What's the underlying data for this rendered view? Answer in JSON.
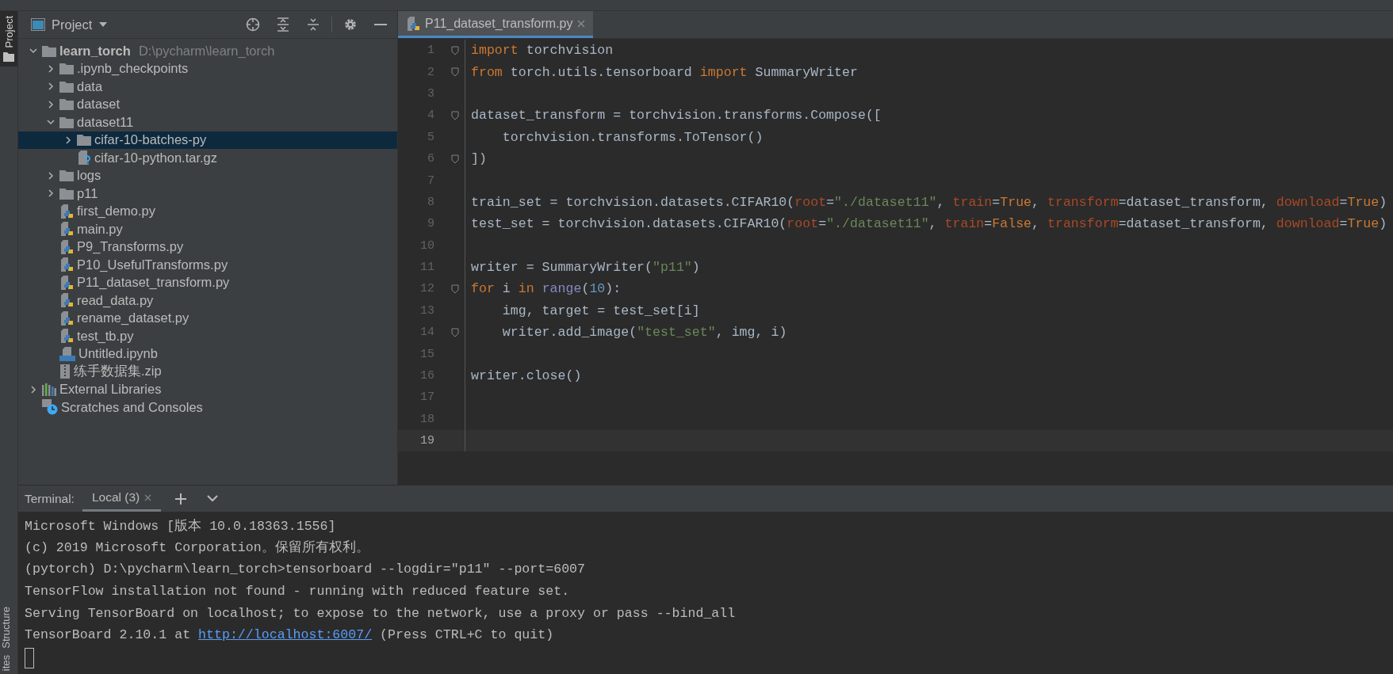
{
  "left_strip": {
    "tabs": [
      {
        "label": "Project",
        "selected": true
      }
    ],
    "bottom_tabs": [
      {
        "label": "Structure"
      },
      {
        "label": "ites"
      }
    ]
  },
  "project_panel": {
    "title": "Project",
    "tree": [
      {
        "label": "learn_torch",
        "path": "D:\\pycharm\\learn_torch",
        "kind": "folder",
        "expanded": true,
        "selected": false,
        "children": [
          {
            "label": ".ipynb_checkpoints",
            "kind": "folder",
            "expanded": false,
            "selected": false
          },
          {
            "label": "data",
            "kind": "folder",
            "expanded": false,
            "selected": false
          },
          {
            "label": "dataset",
            "kind": "folder",
            "expanded": false,
            "selected": false
          },
          {
            "label": "dataset11",
            "kind": "folder",
            "expanded": true,
            "selected": false,
            "children": [
              {
                "label": "cifar-10-batches-py",
                "kind": "folder",
                "expanded": false,
                "selected": true
              },
              {
                "label": "cifar-10-python.tar.gz",
                "kind": "unknown",
                "selected": false
              }
            ]
          },
          {
            "label": "logs",
            "kind": "folder",
            "expanded": false,
            "selected": false
          },
          {
            "label": "p11",
            "kind": "folder",
            "expanded": false,
            "selected": false
          },
          {
            "label": "first_demo.py",
            "kind": "python",
            "selected": false
          },
          {
            "label": "main.py",
            "kind": "python",
            "selected": false
          },
          {
            "label": "P9_Transforms.py",
            "kind": "python",
            "selected": false
          },
          {
            "label": "P10_UsefulTransforms.py",
            "kind": "python",
            "selected": false
          },
          {
            "label": "P11_dataset_transform.py",
            "kind": "python",
            "selected": false
          },
          {
            "label": "read_data.py",
            "kind": "python",
            "selected": false
          },
          {
            "label": "rename_dataset.py",
            "kind": "python",
            "selected": false
          },
          {
            "label": "test_tb.py",
            "kind": "python",
            "selected": false
          },
          {
            "label": "Untitled.ipynb",
            "kind": "notebook",
            "selected": false
          },
          {
            "label": "练手数据集.zip",
            "kind": "zip",
            "selected": false
          }
        ]
      },
      {
        "label": "External Libraries",
        "kind": "libraries",
        "expanded": false,
        "selected": false
      },
      {
        "label": "Scratches and Consoles",
        "kind": "scratches",
        "selected": false
      }
    ]
  },
  "editor": {
    "tabs": [
      {
        "label": "P11_dataset_transform.py",
        "selected": true
      }
    ],
    "lines": [
      {
        "number": "1",
        "fold": true,
        "current": false,
        "tokens": [
          {
            "text": "import",
            "kind": "kw"
          },
          {
            "text": " torchvision",
            "kind": "plain"
          }
        ]
      },
      {
        "number": "2",
        "fold": true,
        "current": false,
        "tokens": [
          {
            "text": "from",
            "kind": "kw"
          },
          {
            "text": " torch.utils.tensorboard ",
            "kind": "plain"
          },
          {
            "text": "import",
            "kind": "kw"
          },
          {
            "text": " SummaryWriter",
            "kind": "plain"
          }
        ]
      },
      {
        "number": "3",
        "fold": false,
        "current": false
      },
      {
        "number": "4",
        "fold": true,
        "current": false,
        "tokens": [
          {
            "text": "dataset_transform = torchvision.transforms.Compose([",
            "kind": "plain"
          }
        ]
      },
      {
        "number": "5",
        "fold": false,
        "current": false,
        "tokens": [
          {
            "text": "    torchvision.transforms.ToTensor()",
            "kind": "plain"
          }
        ]
      },
      {
        "number": "6",
        "fold": true,
        "current": false,
        "tokens": [
          {
            "text": "])",
            "kind": "plain"
          }
        ]
      },
      {
        "number": "7",
        "fold": false,
        "current": false
      },
      {
        "number": "8",
        "fold": false,
        "current": false,
        "tokens": [
          {
            "text": "train_set = torchvision.datasets.CIFAR10(",
            "kind": "plain"
          },
          {
            "text": "root",
            "kind": "param"
          },
          {
            "text": "=",
            "kind": "plain"
          },
          {
            "text": "\"./dataset11\"",
            "kind": "str"
          },
          {
            "text": ", ",
            "kind": "plain"
          },
          {
            "text": "train",
            "kind": "param"
          },
          {
            "text": "=",
            "kind": "plain"
          },
          {
            "text": "True",
            "kind": "kw"
          },
          {
            "text": ", ",
            "kind": "plain"
          },
          {
            "text": "transform",
            "kind": "param"
          },
          {
            "text": "=dataset_transform, ",
            "kind": "plain"
          },
          {
            "text": "download",
            "kind": "param"
          },
          {
            "text": "=",
            "kind": "plain"
          },
          {
            "text": "True",
            "kind": "kw"
          },
          {
            "text": ")",
            "kind": "plain"
          }
        ]
      },
      {
        "number": "9",
        "fold": false,
        "current": false,
        "tokens": [
          {
            "text": "test_set = torchvision.datasets.CIFAR10(",
            "kind": "plain"
          },
          {
            "text": "root",
            "kind": "param"
          },
          {
            "text": "=",
            "kind": "plain"
          },
          {
            "text": "\"./dataset11\"",
            "kind": "str"
          },
          {
            "text": ", ",
            "kind": "plain"
          },
          {
            "text": "train",
            "kind": "param"
          },
          {
            "text": "=",
            "kind": "plain"
          },
          {
            "text": "False",
            "kind": "kw"
          },
          {
            "text": ", ",
            "kind": "plain"
          },
          {
            "text": "transform",
            "kind": "param"
          },
          {
            "text": "=dataset_transform, ",
            "kind": "plain"
          },
          {
            "text": "download",
            "kind": "param"
          },
          {
            "text": "=",
            "kind": "plain"
          },
          {
            "text": "True",
            "kind": "kw"
          },
          {
            "text": ")",
            "kind": "plain"
          }
        ]
      },
      {
        "number": "10",
        "fold": false,
        "current": false
      },
      {
        "number": "11",
        "fold": false,
        "current": false,
        "tokens": [
          {
            "text": "writer = SummaryWriter(",
            "kind": "plain"
          },
          {
            "text": "\"p11\"",
            "kind": "str"
          },
          {
            "text": ")",
            "kind": "plain"
          }
        ]
      },
      {
        "number": "12",
        "fold": true,
        "current": false,
        "tokens": [
          {
            "text": "for",
            "kind": "kw"
          },
          {
            "text": " i ",
            "kind": "plain"
          },
          {
            "text": "in ",
            "kind": "kw"
          },
          {
            "text": "range",
            "kind": "builtin"
          },
          {
            "text": "(",
            "kind": "plain"
          },
          {
            "text": "10",
            "kind": "num"
          },
          {
            "text": "):",
            "kind": "plain"
          }
        ]
      },
      {
        "number": "13",
        "fold": false,
        "current": false,
        "tokens": [
          {
            "text": "    img, target = test_set[i]",
            "kind": "plain"
          }
        ]
      },
      {
        "number": "14",
        "fold": true,
        "current": false,
        "tokens": [
          {
            "text": "    writer.add_image(",
            "kind": "plain"
          },
          {
            "text": "\"test_set\"",
            "kind": "str"
          },
          {
            "text": ", img, i)",
            "kind": "plain"
          }
        ]
      },
      {
        "number": "15",
        "fold": false,
        "current": false
      },
      {
        "number": "16",
        "fold": false,
        "current": false,
        "tokens": [
          {
            "text": "writer.close()",
            "kind": "plain"
          }
        ]
      },
      {
        "number": "17",
        "fold": false,
        "current": false
      },
      {
        "number": "18",
        "fold": false,
        "current": false
      },
      {
        "number": "19",
        "fold": false,
        "current": true
      }
    ]
  },
  "terminal": {
    "label": "Terminal:",
    "tabs": [
      {
        "label": "Local (3)",
        "selected": true
      }
    ],
    "lines": [
      {
        "text": "Microsoft Windows [版本 10.0.18363.1556]"
      },
      {
        "text": "(c) 2019 Microsoft Corporation。保留所有权利。"
      },
      {
        "text": "(pytorch) D:\\pycharm\\learn_torch>tensorboard --logdir=\"p11\" --port=6007"
      },
      {
        "text": "TensorFlow installation not found - running with reduced feature set."
      },
      {
        "text": "Serving TensorBoard on localhost; to expose to the network, use a proxy or pass --bind_all"
      },
      {
        "text": "TensorBoard 2.10.1 at ",
        "link": "http://localhost:6007/",
        "after": " (Press CTRL+C to quit)"
      }
    ]
  }
}
